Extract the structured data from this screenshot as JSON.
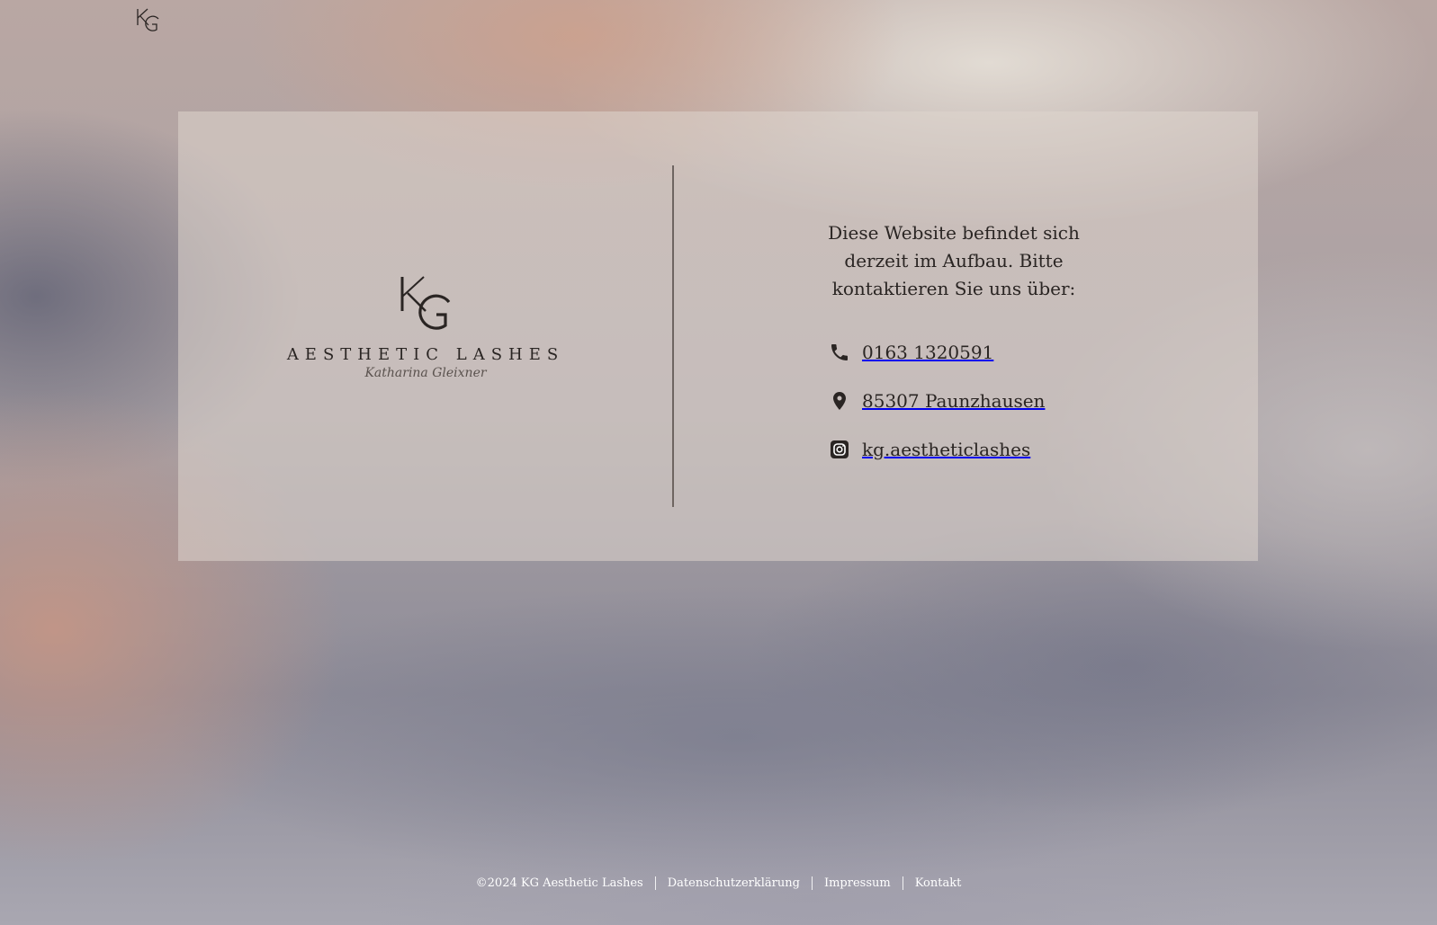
{
  "header": {
    "logo_icon": "kg-monogram-icon"
  },
  "brand": {
    "monogram": "KG",
    "name": "AESTHETIC LASHES",
    "signature": "Katharina Gleixner"
  },
  "notice": {
    "message": "Diese Website befindet sich derzeit im Aufbau. Bitte kontaktieren Sie uns über:"
  },
  "contacts": [
    {
      "icon": "phone-icon",
      "text": "0163 1320591"
    },
    {
      "icon": "location-pin-icon",
      "text": "85307 Paunzhausen"
    },
    {
      "icon": "instagram-icon",
      "text": "kg.aestheticlashes"
    }
  ],
  "footer": {
    "copyright": "©2024 KG Aesthetic Lashes",
    "links": [
      "Datenschutzerklärung",
      "Impressum",
      "Kontakt"
    ]
  },
  "colors": {
    "text": "#2a2523",
    "card": "#ded6cd",
    "divider": "#6e6561",
    "footer_text": "#ffffff"
  }
}
